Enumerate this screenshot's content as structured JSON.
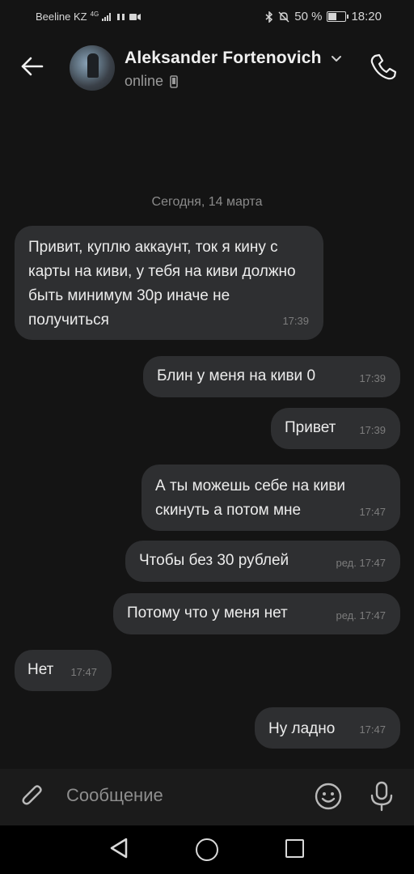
{
  "status_bar": {
    "carrier": "Beeline KZ",
    "network": "4G",
    "battery_percent_text": "50 %",
    "battery_level": 0.5,
    "time": "18:20"
  },
  "header": {
    "contact_name": "Aleksander Fortenovich",
    "presence": "online",
    "icons": [
      "back-arrow-icon",
      "chevron-down-icon",
      "mobile-device-icon",
      "phone-icon"
    ]
  },
  "chat": {
    "date_label": "Сегодня, 14 марта",
    "messages": [
      {
        "side": "incoming",
        "text": "Привит, куплю аккаунт, ток я кину с карты на киви, у тебя на киви должно быть минимум 30р иначе не получиться",
        "time": "17:39"
      },
      {
        "side": "outgoing",
        "text": "Блин у меня на киви 0",
        "time": "17:39"
      },
      {
        "side": "outgoing",
        "text": "Привет",
        "time": "17:39"
      },
      {
        "side": "outgoing",
        "text": "А ты можешь себе на киви скинуть а потом мне",
        "time": "17:47"
      },
      {
        "side": "outgoing",
        "text": "Чтобы без 30 рублей",
        "time": "ред. 17:47"
      },
      {
        "side": "outgoing",
        "text": "Потому что у меня нет",
        "time": "ред. 17:47"
      },
      {
        "side": "incoming",
        "text": "Нет",
        "time": "17:47"
      },
      {
        "side": "outgoing",
        "text": "Ну ладно",
        "time": "17:47"
      }
    ]
  },
  "composer": {
    "placeholder": "Сообщение",
    "icons": [
      "attach-icon",
      "emoji-icon",
      "microphone-icon"
    ]
  },
  "navbar": {
    "icons": [
      "nav-back-icon",
      "nav-home-icon",
      "nav-recents-icon"
    ]
  },
  "colors": {
    "background": "#141414",
    "bubble": "#2e2f31",
    "text": "#ececec",
    "secondary": "#8a8a8a"
  }
}
